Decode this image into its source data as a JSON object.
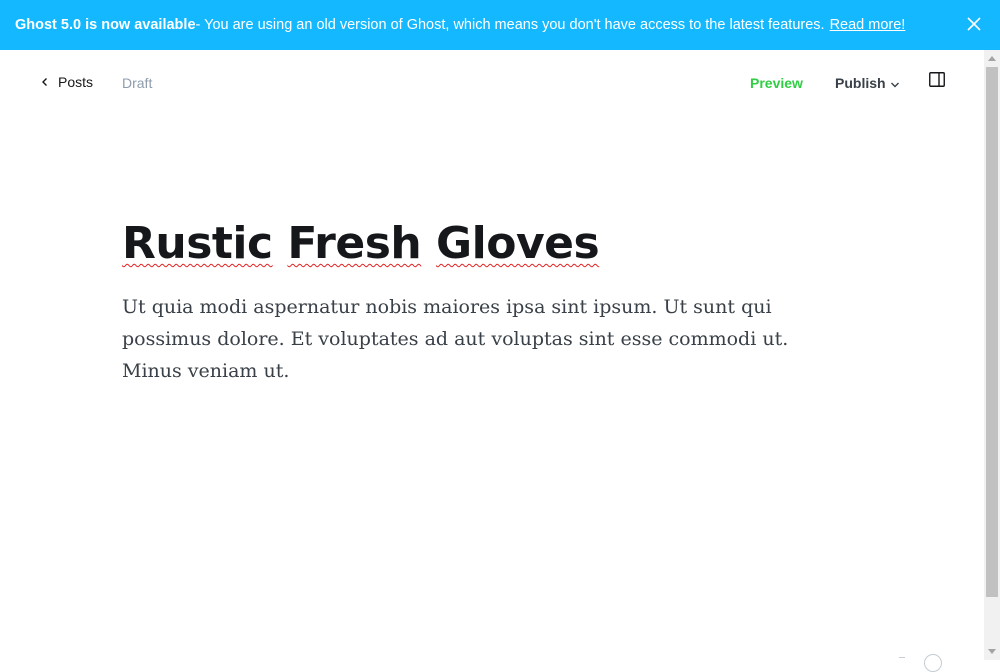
{
  "banner": {
    "strong_text": "Ghost 5.0 is now available",
    "message": " - You are using an old version of Ghost, which means you don't have access to the latest features.",
    "link_text": "Read more!",
    "background": "#14b8ff",
    "close_icon": "close-icon"
  },
  "header": {
    "back_label": "Posts",
    "status": "Draft",
    "preview_label": "Preview",
    "publish_label": "Publish",
    "preview_color": "#30cf43",
    "sidebar_icon": "sidebar-toggle-icon"
  },
  "post": {
    "title_words": [
      "Rustic",
      "Fresh",
      "Gloves"
    ],
    "body": "Ut quia modi aspernatur nobis maiores ipsa sint ipsum. Ut sunt qui possimus dolore. Et voluptates ad aut voluptas sint esse commodi ut. Minus veniam ut."
  }
}
